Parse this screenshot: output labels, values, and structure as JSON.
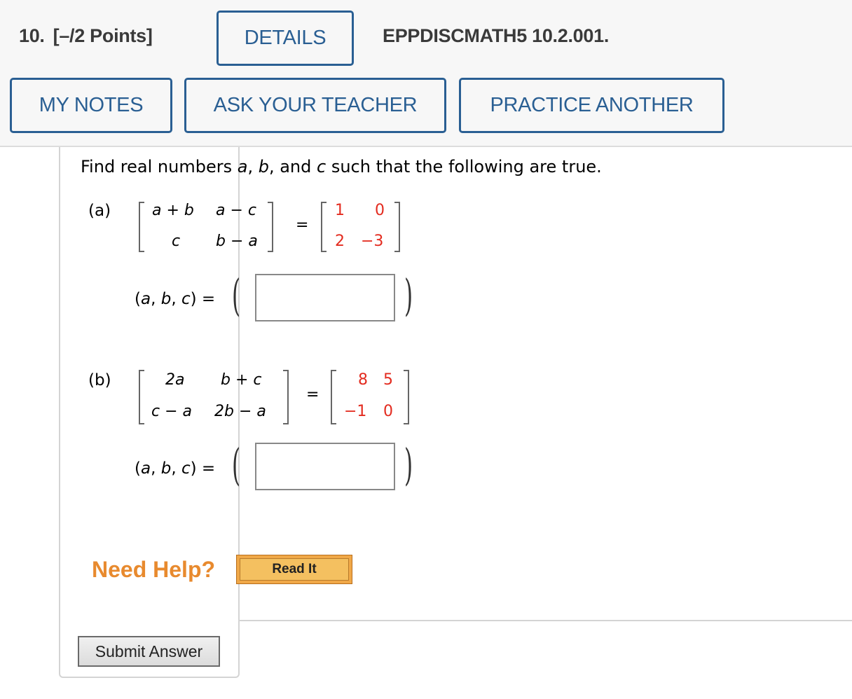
{
  "header": {
    "question_number": "10.",
    "points": "[–/2 Points]",
    "details_label": "DETAILS",
    "question_code": "EPPDISCMATH5 10.2.001.",
    "my_notes_label": "MY NOTES",
    "ask_teacher_label": "ASK YOUR TEACHER",
    "practice_another_label": "PRACTICE ANOTHER"
  },
  "prompt": {
    "before_a": "Find real numbers ",
    "a": "a",
    "sep1": ", ",
    "b": "b",
    "sep2": ", and ",
    "c": "c",
    "after": " such that the following are true."
  },
  "parts": [
    {
      "label": "(a)",
      "lhs": [
        [
          "a + b",
          "a − c"
        ],
        [
          "c",
          "b − a"
        ]
      ],
      "rhs": [
        [
          "1",
          "0"
        ],
        [
          "2",
          "−3"
        ]
      ],
      "equals": "=",
      "answer_label": {
        "open": "(",
        "a": "a",
        "c1": ", ",
        "b": "b",
        "c2": ", ",
        "c": "c",
        "close": ") ="
      },
      "answer_value": ""
    },
    {
      "label": "(b)",
      "lhs": [
        [
          "2a",
          "b + c"
        ],
        [
          "c − a",
          "2b − a"
        ]
      ],
      "rhs": [
        [
          "8",
          "5"
        ],
        [
          "−1",
          "0"
        ]
      ],
      "equals": "=",
      "answer_label": {
        "open": "(",
        "a": "a",
        "c1": ", ",
        "b": "b",
        "c2": ", ",
        "c": "c",
        "close": ") ="
      },
      "answer_value": ""
    }
  ],
  "help": {
    "need_help_label": "Need Help?",
    "read_it_label": "Read It"
  },
  "submit_label": "Submit Answer",
  "colors": {
    "accent_blue": "#2a5f93",
    "given_values_red": "#e32b1f",
    "need_help_orange": "#e88a2e"
  }
}
